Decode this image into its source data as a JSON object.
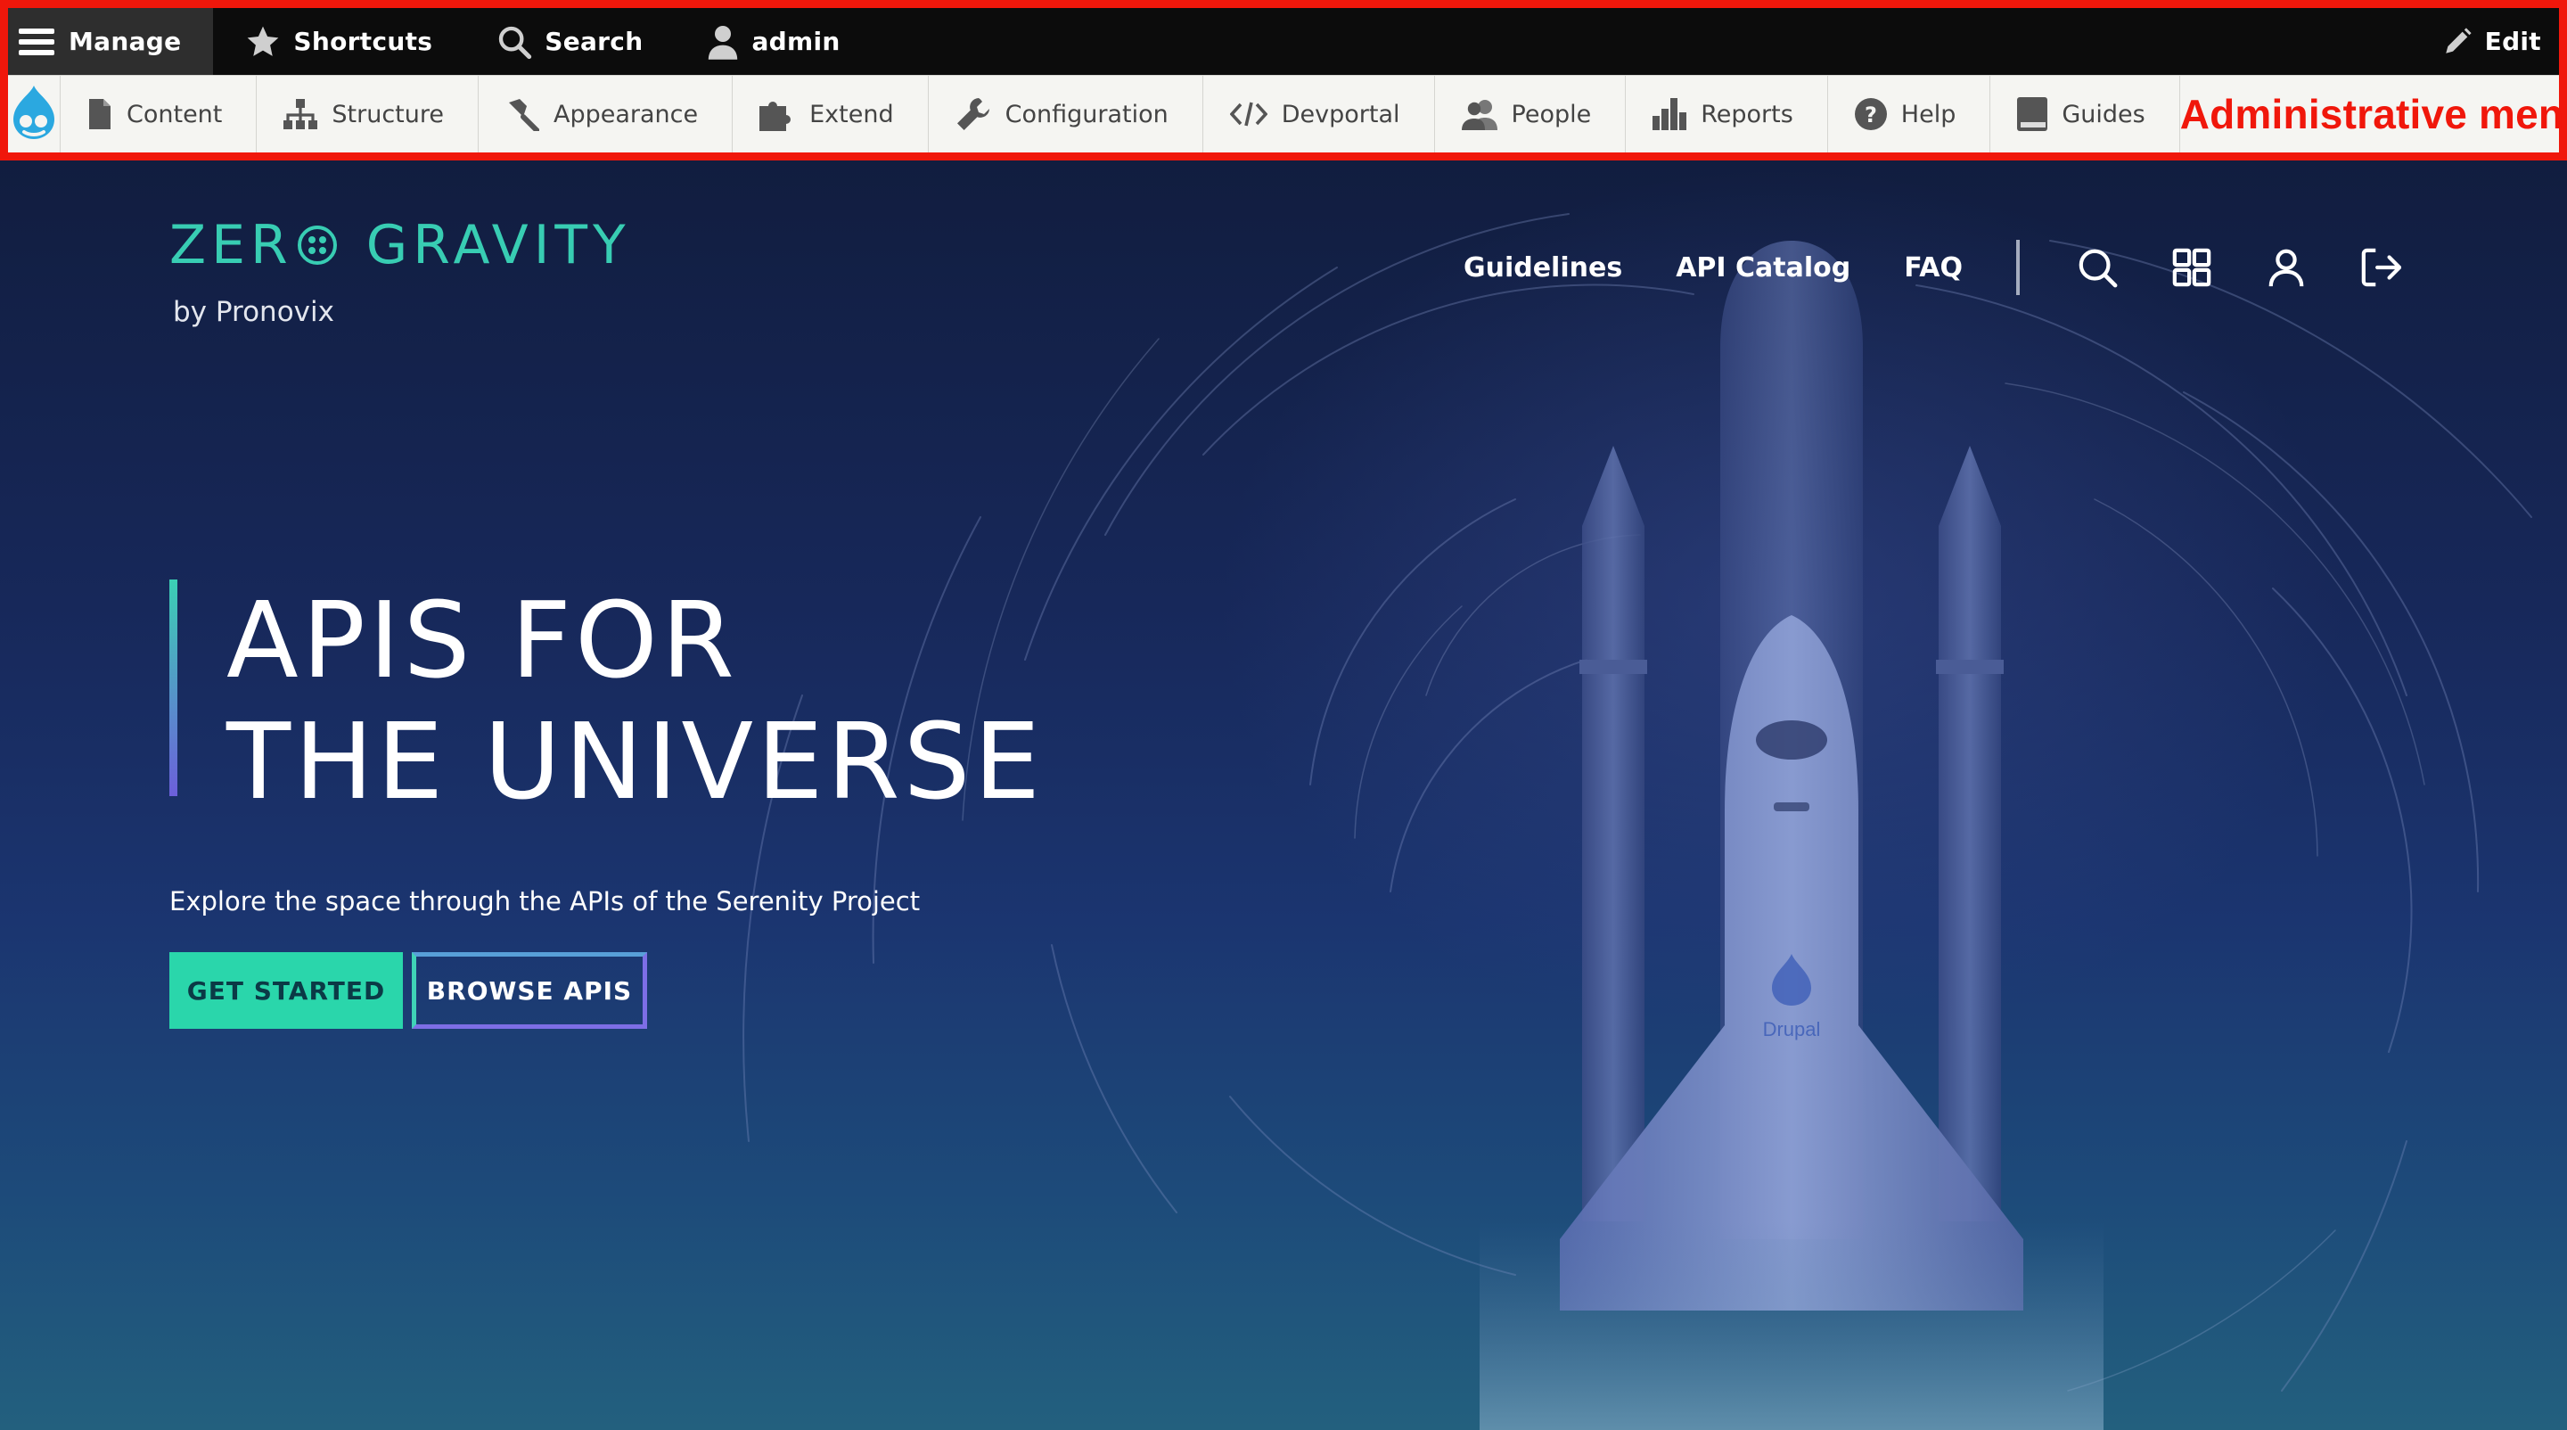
{
  "admin_toolbar": {
    "top": {
      "manage": "Manage",
      "shortcuts": "Shortcuts",
      "search": "Search",
      "user": "admin",
      "edit": "Edit"
    },
    "tray": {
      "items": [
        {
          "label": "Content",
          "icon": "document-icon"
        },
        {
          "label": "Structure",
          "icon": "sitemap-icon"
        },
        {
          "label": "Appearance",
          "icon": "brush-icon"
        },
        {
          "label": "Extend",
          "icon": "puzzle-icon"
        },
        {
          "label": "Configuration",
          "icon": "wrench-icon"
        },
        {
          "label": "Devportal",
          "icon": "code-icon"
        },
        {
          "label": "People",
          "icon": "people-icon"
        },
        {
          "label": "Reports",
          "icon": "bar-chart-icon"
        },
        {
          "label": "Help",
          "icon": "help-icon"
        },
        {
          "label": "Guides",
          "icon": "book-icon"
        }
      ],
      "annotation": "Administrative menu"
    },
    "frame_color": "#f0170b"
  },
  "site": {
    "brand": {
      "name_part1": "ZER",
      "name_part2": "GRAVITY",
      "byline": "by Pronovix",
      "color": "#38cdb3"
    },
    "nav": {
      "links": [
        "Guidelines",
        "API Catalog",
        "FAQ"
      ],
      "icons": [
        "search-icon",
        "grid-icon",
        "user-icon",
        "logout-icon"
      ]
    },
    "hero": {
      "headline_line1": "APIS FOR",
      "headline_line2": "THE UNIVERSE",
      "tagline": "Explore the space through the APIs of the Serenity Project",
      "primary_cta": "GET STARTED",
      "secondary_cta": "BROWSE APIS",
      "shuttle_badge": "Drupal"
    },
    "colors": {
      "accent_teal": "#2ad6ab",
      "accent_purple": "#7d6ee6"
    }
  }
}
